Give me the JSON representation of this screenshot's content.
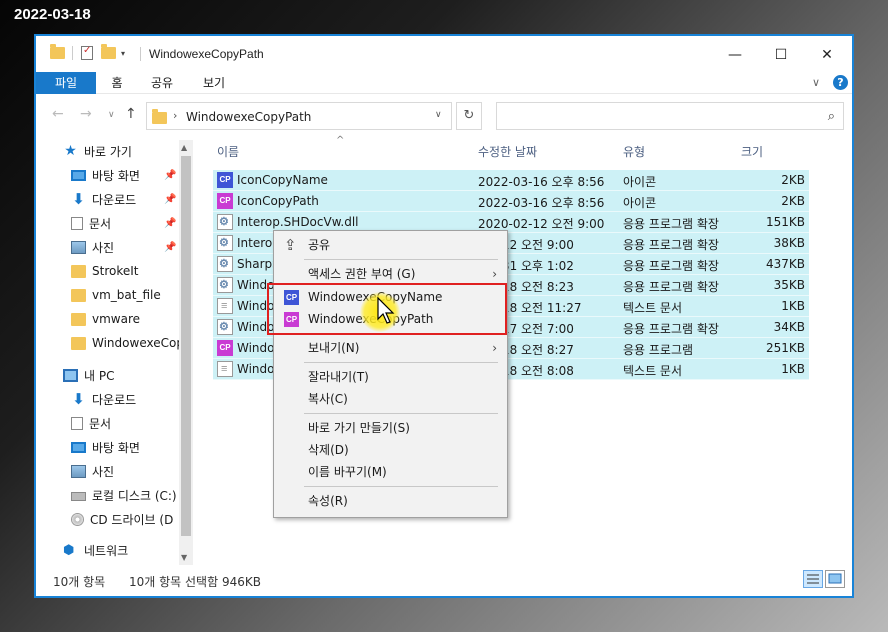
{
  "date_label": "2022-03-18",
  "window": {
    "title": "WindowexeCopyPath",
    "controls": {
      "minimize": "—",
      "maximize": "☐",
      "close": "✕"
    }
  },
  "ribbon": {
    "tabs": [
      "파일",
      "홈",
      "공유",
      "보기"
    ],
    "expand": "∨",
    "help": "?"
  },
  "address": {
    "back": "←",
    "forward": "→",
    "recent": "∨",
    "up": "↑",
    "separator": "›",
    "path": "WindowexeCopyPath",
    "dropdown": "∨",
    "refresh": "↻",
    "search_icon": "⌕"
  },
  "nav": {
    "items": [
      {
        "label": "바로 가기",
        "icon": "star-icon",
        "pinned": false
      },
      {
        "label": "바탕 화면",
        "icon": "desktop-icon",
        "pinned": true
      },
      {
        "label": "다운로드",
        "icon": "download-icon",
        "pinned": true
      },
      {
        "label": "문서",
        "icon": "document-icon",
        "pinned": true
      },
      {
        "label": "사진",
        "icon": "pictures-icon",
        "pinned": true
      },
      {
        "label": "StrokeIt",
        "icon": "folder-icon",
        "pinned": false
      },
      {
        "label": "vm_bat_file",
        "icon": "folder-icon",
        "pinned": false
      },
      {
        "label": "vmware",
        "icon": "folder-icon",
        "pinned": false
      },
      {
        "label": "WindowexeCopy",
        "icon": "folder-icon",
        "pinned": false
      },
      {
        "label": "내 PC",
        "icon": "pc-icon",
        "pinned": false
      },
      {
        "label": "다운로드",
        "icon": "download-icon",
        "pinned": false
      },
      {
        "label": "문서",
        "icon": "document-icon",
        "pinned": false
      },
      {
        "label": "바탕 화면",
        "icon": "desktop-icon",
        "pinned": false
      },
      {
        "label": "사진",
        "icon": "pictures-icon",
        "pinned": false
      },
      {
        "label": "로컬 디스크 (C:)",
        "icon": "disk-icon",
        "pinned": false
      },
      {
        "label": "CD 드라이브 (D",
        "icon": "cd-drive-icon",
        "pinned": false
      },
      {
        "label": "네트워크",
        "icon": "network-icon",
        "pinned": false
      }
    ],
    "pin_glyph": "📌"
  },
  "columns": {
    "name": "이름",
    "date": "수정한 날짜",
    "type": "유형",
    "size": "크기",
    "sort": "^"
  },
  "files": [
    {
      "icon": "CP",
      "kind": "cp1",
      "name": "IconCopyName",
      "date": "2022-03-16 오후 8:56",
      "type": "아이콘",
      "size": "2KB"
    },
    {
      "icon": "CP",
      "kind": "cp2",
      "name": "IconCopyPath",
      "date": "2022-03-16 오후 8:56",
      "type": "아이콘",
      "size": "2KB"
    },
    {
      "icon": "",
      "kind": "dll",
      "name": "Interop.SHDocVw.dll",
      "date": "2020-02-12 오전 9:00",
      "type": "응용 프로그램 확장",
      "size": "151KB"
    },
    {
      "icon": "",
      "kind": "dll",
      "name": "Interop",
      "date": "-02-12 오전 9:00",
      "type": "응용 프로그램 확장",
      "size": "38KB"
    },
    {
      "icon": "",
      "kind": "dll",
      "name": "SharpS",
      "date": "-05-31 오후 1:02",
      "type": "응용 프로그램 확장",
      "size": "437KB"
    },
    {
      "icon": "",
      "kind": "dll",
      "name": "Windo",
      "date": "-03-18 오전 8:23",
      "type": "응용 프로그램 확장",
      "size": "35KB"
    },
    {
      "icon": "",
      "kind": "txt",
      "name": "Windo",
      "date": "-03-18 오전 11:27",
      "type": "텍스트 문서",
      "size": "1KB"
    },
    {
      "icon": "",
      "kind": "dll",
      "name": "Windo",
      "date": "-03-17 오전 7:00",
      "type": "응용 프로그램 확장",
      "size": "34KB"
    },
    {
      "icon": "CP",
      "kind": "cp2",
      "name": "Windo",
      "date": "-03-18 오전 8:27",
      "type": "응용 프로그램",
      "size": "251KB"
    },
    {
      "icon": "",
      "kind": "txt",
      "name": "Windo",
      "date": "-03-18 오전 8:08",
      "type": "텍스트 문서",
      "size": "1KB"
    }
  ],
  "context_menu": {
    "share": "공유",
    "share_icon": "⇪",
    "access": "액세스 권한 부여 (G)",
    "copy_name": "WindowexeCopyName",
    "copy_path": "WindowexeCopyPath",
    "send_to": "보내기(N)",
    "cut": "잘라내기(T)",
    "copy": "복사(C)",
    "shortcut": "바로 가기 만들기(S)",
    "delete": "삭제(D)",
    "rename": "이름 바꾸기(M)",
    "properties": "속성(R)",
    "submenu_arrow": "›",
    "cp_badge": "CP"
  },
  "status": {
    "count": "10개 항목",
    "selected": "10개 항목 선택함 946KB"
  },
  "colors": {
    "accent": "#1979ca",
    "selection": "#cdf1f6",
    "highlight_box": "#e02020",
    "cp_blue": "#3e55d6",
    "cp_pink": "#c93bd3"
  }
}
